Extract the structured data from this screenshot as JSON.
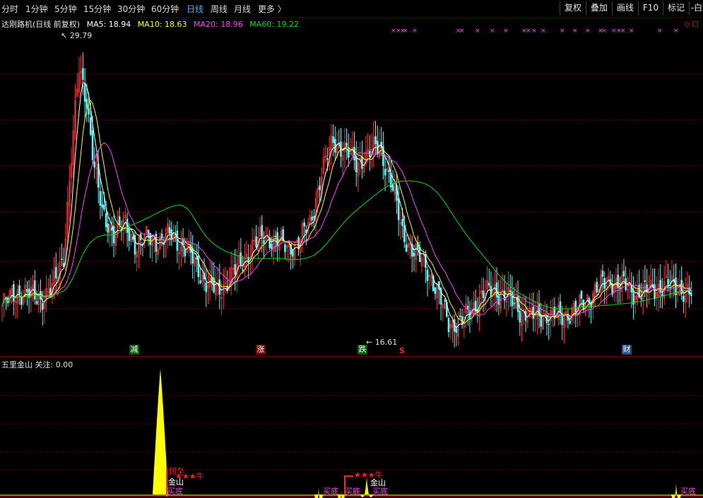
{
  "toolbar": {
    "timeframes": [
      "分时",
      "1分钟",
      "5分钟",
      "15分钟",
      "30分钟",
      "60分钟",
      "日线",
      "周线",
      "月线",
      "更多 〉"
    ],
    "active_timeframe": "日线",
    "buttons": [
      "复权",
      "叠加",
      "画线",
      "F10",
      "标记",
      "-白"
    ]
  },
  "main_chart": {
    "title": "达刚路机(日线 前复权)",
    "ma": [
      {
        "label": "MA5: 18.94",
        "color": "#ffffff"
      },
      {
        "label": "MA10: 18.63",
        "color": "#ffff00"
      },
      {
        "label": "MA20: 18.96",
        "color": "#ff40ff"
      },
      {
        "label": "MA60: 19.22",
        "color": "#00e000"
      }
    ],
    "high_label": "29.79",
    "low_label": "16.61",
    "event_badges": [
      {
        "text": "减",
        "color": "#00a000",
        "border": "#00a000"
      },
      {
        "text": "涨",
        "color": "#cc0000",
        "border": "#cc0000"
      },
      {
        "text": "跌",
        "color": "#00a000",
        "border": "#00a000"
      },
      {
        "text": "财",
        "color": "#2a7fd4",
        "border": "#2a7fd4"
      }
    ],
    "s_marker": "S",
    "corner_icons": [
      "◇",
      "□"
    ]
  },
  "sub_chart": {
    "title": "五里金山",
    "watch_label": "关注: 0.00",
    "signals": {
      "sell_top": "顾至",
      "gold": "金山",
      "stars": "★★★牛",
      "buy_bottom": "买底"
    }
  },
  "colors": {
    "up": "#ff3232",
    "down": "#54fcfc",
    "ma5": "#ffffff",
    "ma10": "#ffff00",
    "ma20": "#ff40ff",
    "ma60": "#00e000",
    "grid": "#800000",
    "signal_fill": "#ffff00",
    "signal_text_red": "#ff2020",
    "signal_text_magenta": "#ff40ff"
  }
}
